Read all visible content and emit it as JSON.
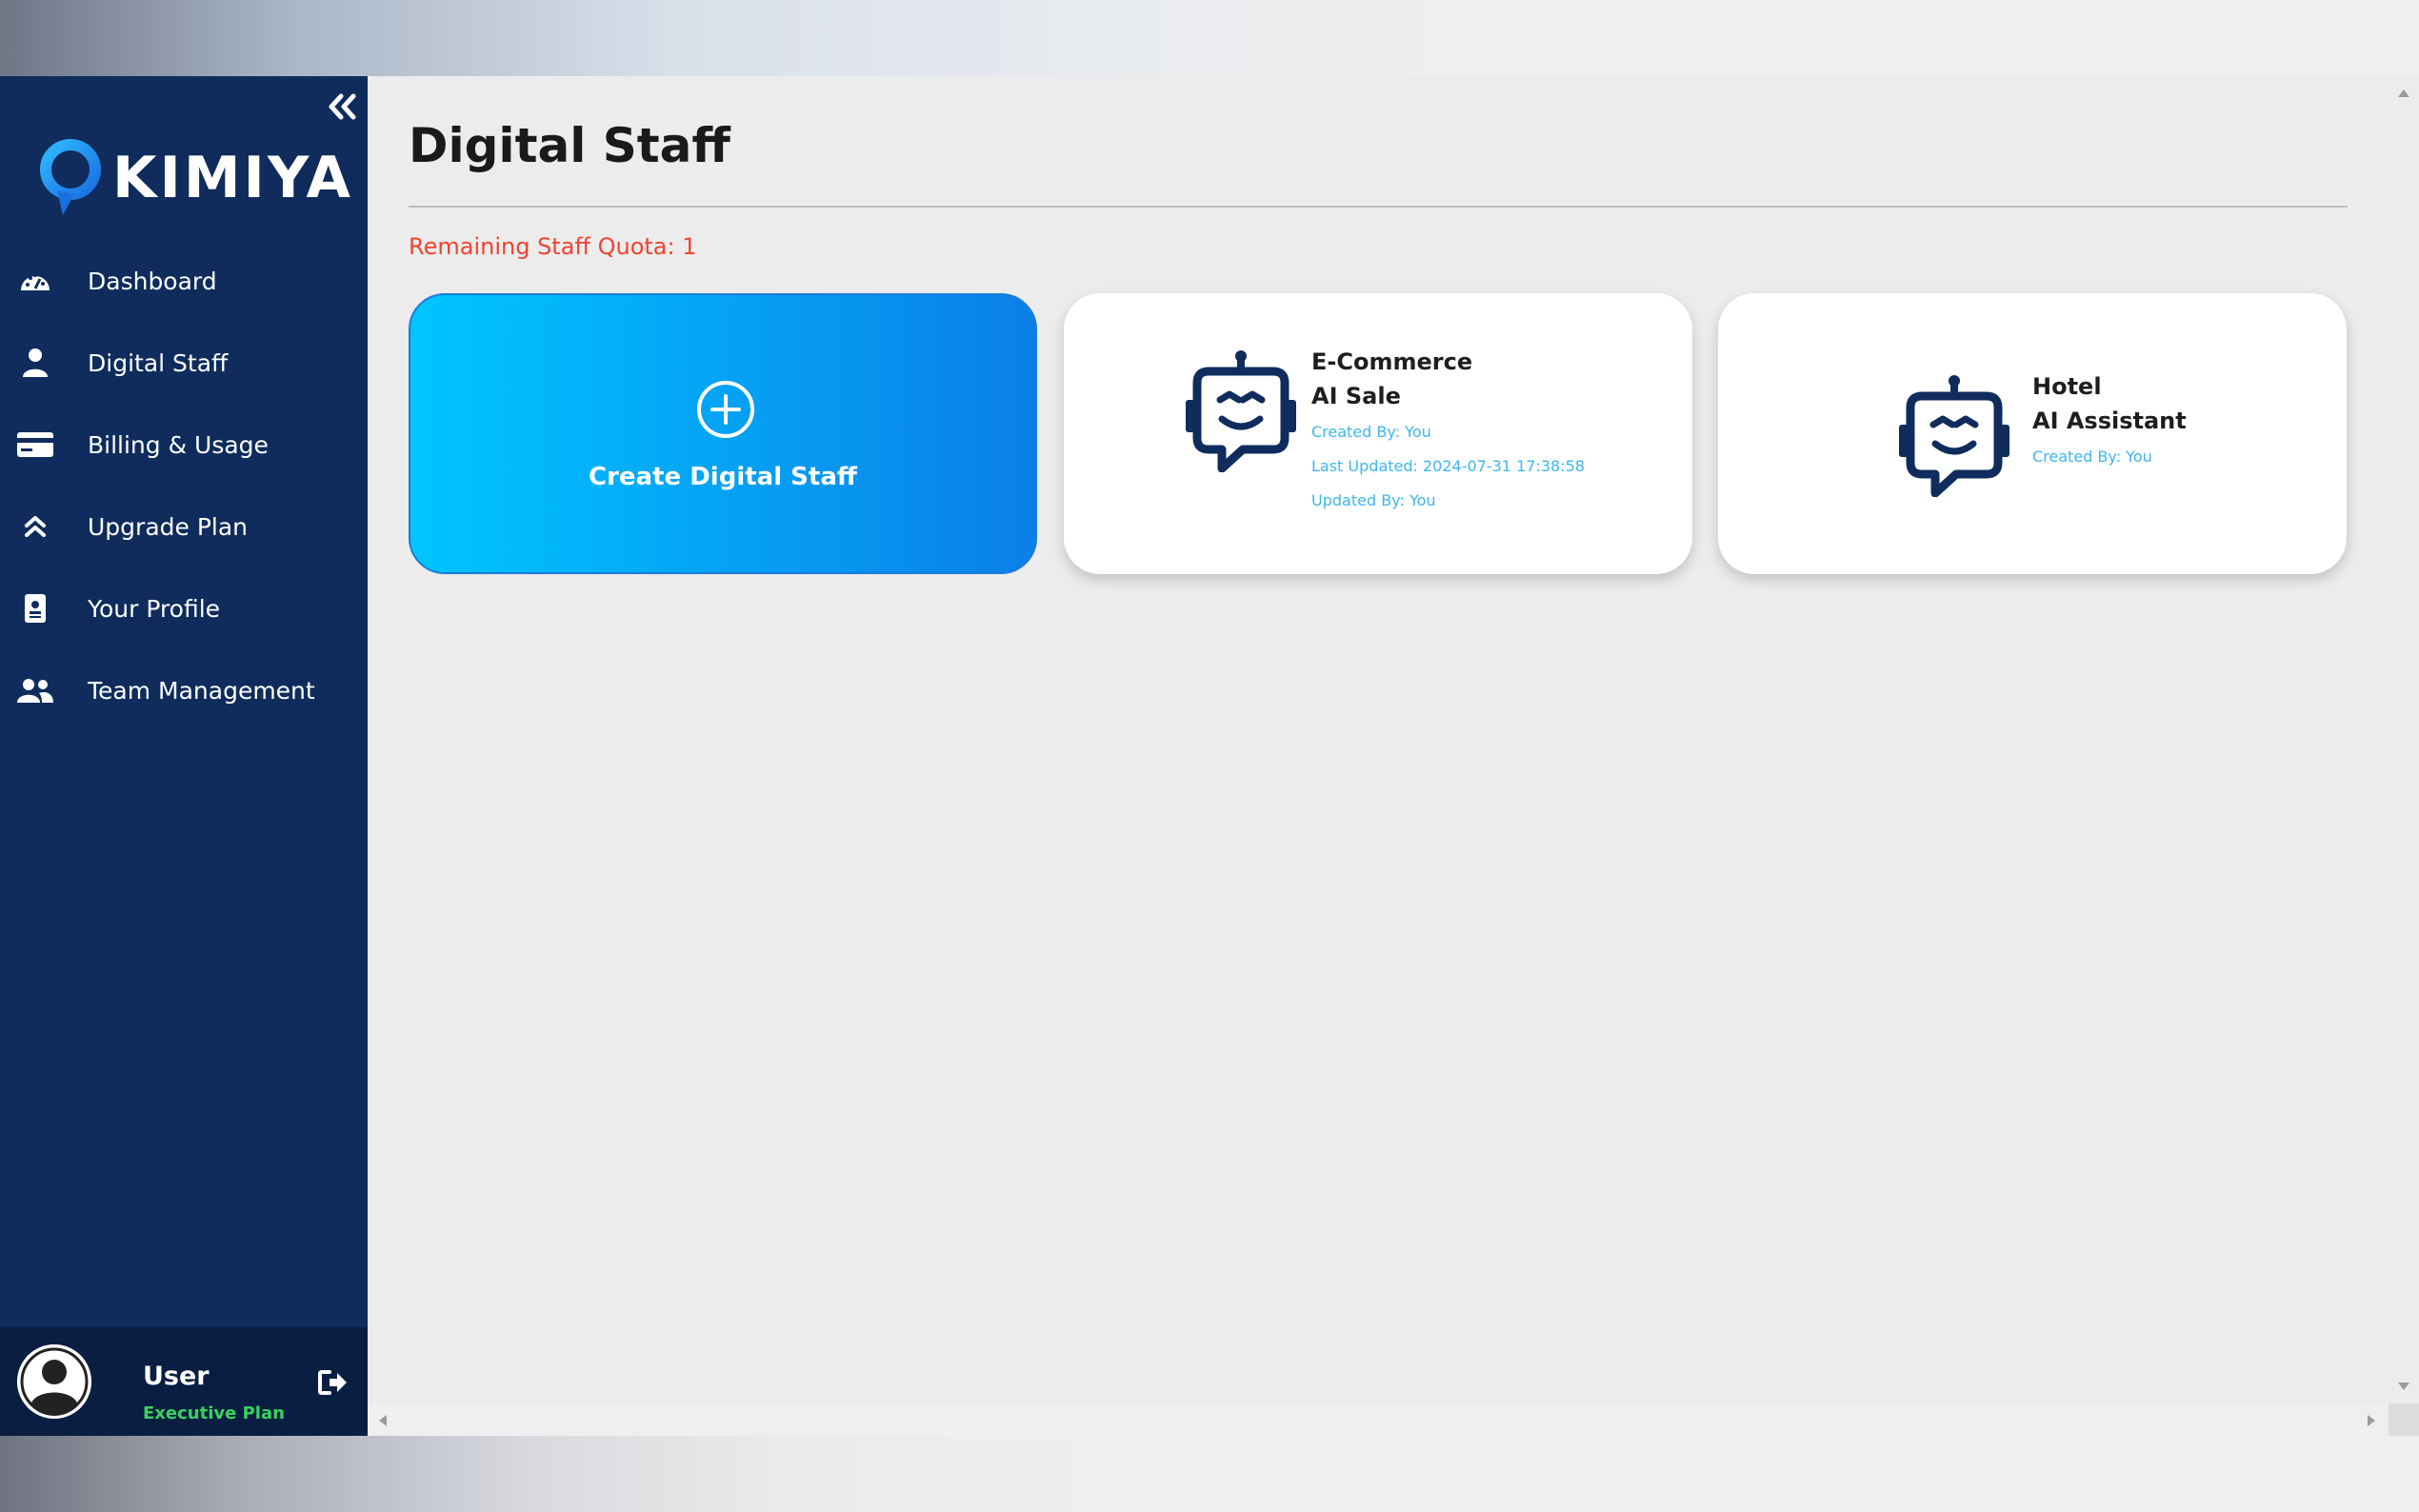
{
  "sidebar": {
    "brand": "KIMIYA",
    "items": [
      {
        "label": "Dashboard",
        "icon": "dashboard-gauge-icon"
      },
      {
        "label": "Digital Staff",
        "icon": "user-icon"
      },
      {
        "label": "Billing & Usage",
        "icon": "credit-card-icon"
      },
      {
        "label": "Upgrade Plan",
        "icon": "double-chevron-up-icon"
      },
      {
        "label": "Your Profile",
        "icon": "id-badge-icon"
      },
      {
        "label": "Team Management",
        "icon": "users-icon"
      }
    ],
    "user": {
      "name": "User",
      "plan": "Executive Plan"
    }
  },
  "main": {
    "title": "Digital Staff",
    "quota": "Remaining Staff Quota: 1",
    "create_label": "Create Digital Staff",
    "staff": [
      {
        "title_line1": "E-Commerce",
        "title_line2": "AI Sale",
        "created_by": "Created By: You",
        "last_updated": "Last Updated: 2024-07-31 17:38:58",
        "updated_by": "Updated By: You"
      },
      {
        "title_line1": "Hotel",
        "title_line2": "AI Assistant",
        "created_by": "Created By: You"
      }
    ]
  },
  "colors": {
    "sidebar_bg": "#0f2c5c",
    "accent_gradient_start": "#00c6ff",
    "accent_gradient_end": "#0a7fe8",
    "quota_text": "#f0432f",
    "meta_text": "#3cb7f0",
    "plan_text": "#39d35f"
  }
}
